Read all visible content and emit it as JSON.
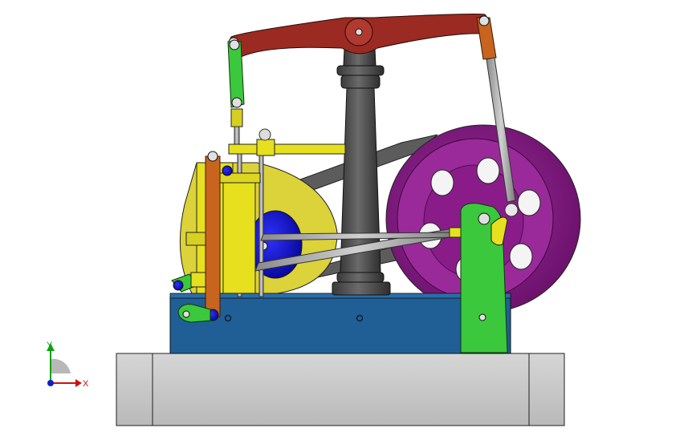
{
  "viewport": {
    "background": "#ffffff"
  },
  "triad": {
    "x_label": "X",
    "y_label": "Y",
    "x_color": "#d01010",
    "y_color": "#10a010",
    "z_color": "#1020c0"
  },
  "model": {
    "parts": [
      {
        "name": "base-plate",
        "color": "#c8c8c8"
      },
      {
        "name": "engine-bed",
        "color": "#1f5f96"
      },
      {
        "name": "walking-beam",
        "color": "#9a2a22"
      },
      {
        "name": "center-column",
        "color": "#4d4d4d"
      },
      {
        "name": "flywheel",
        "color": "#8c1f8c"
      },
      {
        "name": "crank-bracket",
        "color": "#3cc83c"
      },
      {
        "name": "cylinder",
        "color": "#e6e61e"
      },
      {
        "name": "eccentric-disk",
        "color": "#1414d2"
      },
      {
        "name": "valve-lever",
        "color": "#c8641e"
      },
      {
        "name": "connecting-rod",
        "color": "#9a9a9a"
      }
    ]
  }
}
